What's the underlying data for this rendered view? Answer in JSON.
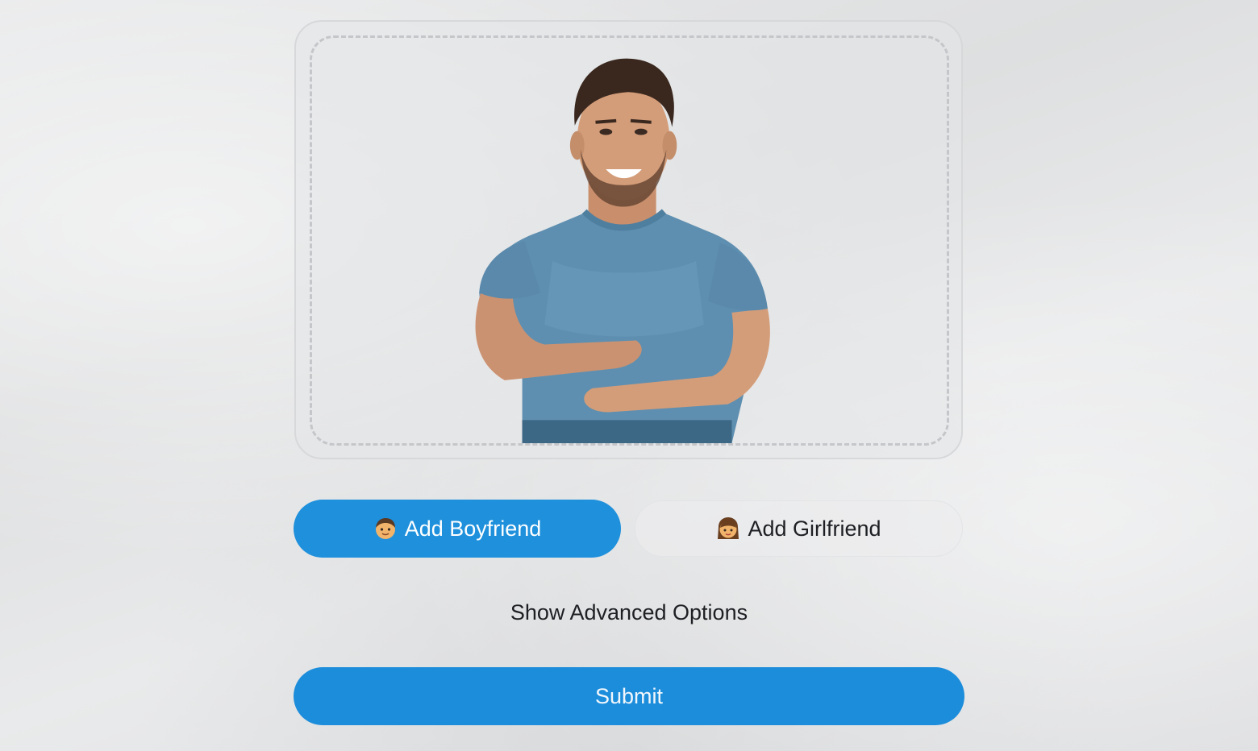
{
  "upload": {
    "image_alt": "Smiling man in blue t-shirt with crossed arms"
  },
  "actions": {
    "add_boyfriend_emoji": "man-emoji",
    "add_boyfriend_label": "Add Boyfriend",
    "add_girlfriend_emoji": "woman-emoji",
    "add_girlfriend_label": "Add Girlfriend",
    "advanced_toggle_label": "Show Advanced Options",
    "submit_label": "Submit"
  },
  "colors": {
    "primary": "#1e90dc",
    "background": "#e6e7e8",
    "text": "#1d1f23"
  }
}
